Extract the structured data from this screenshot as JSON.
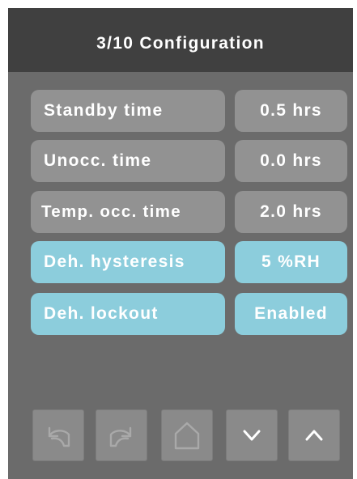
{
  "header": {
    "title": "3/10 Configuration"
  },
  "settings": [
    {
      "label": "Standby time",
      "value": "0.5 hrs",
      "state": "normal"
    },
    {
      "label": "Unocc. time",
      "value": "0.0 hrs",
      "state": "normal"
    },
    {
      "label": "Temp. occ. time",
      "value": "2.0 hrs",
      "state": "normal"
    },
    {
      "label": "Deh. hysteresis",
      "value": "5 %RH",
      "state": "highlighted"
    },
    {
      "label": "Deh. lockout",
      "value": "Enabled",
      "state": "highlighted"
    }
  ],
  "nav": {
    "buttons": [
      {
        "name": "undo",
        "icon": "undo-arrow-icon"
      },
      {
        "name": "redo",
        "icon": "redo-arrow-icon"
      },
      {
        "name": "home",
        "icon": "home-icon"
      },
      {
        "name": "down",
        "icon": "chevron-down-icon"
      },
      {
        "name": "up",
        "icon": "chevron-up-icon"
      }
    ]
  },
  "colors": {
    "background": "#6b6b6b",
    "header": "#404040",
    "row_gray": "#929292",
    "row_highlight": "#8ccddc",
    "nav_button": "#8a8a8a",
    "icon_stroke": "#a9a9a9",
    "text": "#ffffff"
  }
}
